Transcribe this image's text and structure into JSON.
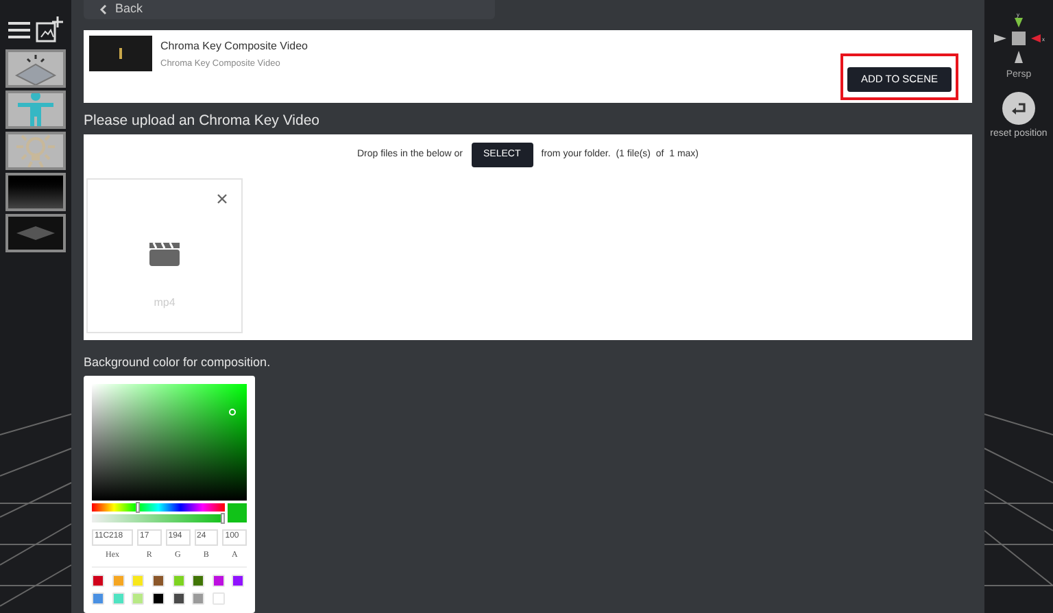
{
  "back_button": {
    "label": "Back"
  },
  "sidebar": {
    "items": [
      {
        "kind": "grid"
      },
      {
        "kind": "figure"
      },
      {
        "kind": "light"
      },
      {
        "kind": "gradient"
      },
      {
        "kind": "plane"
      }
    ]
  },
  "video_card": {
    "title": "Chroma Key Composite Video",
    "subtitle": "Chroma Key Composite Video",
    "add_button": {
      "label": "ADD TO SCENE",
      "highlighted": true
    }
  },
  "upload": {
    "heading": "Please upload an Chroma Key Video",
    "prompt_before": "Drop files in the below or",
    "select_button": "SELECT",
    "prompt_after": "from your folder.  (1 file(s)  of  1 max)",
    "files": [
      {
        "type": "mp4"
      }
    ]
  },
  "background": {
    "heading": "Background color for composition.",
    "picker": {
      "hex": "11C218",
      "r": "17",
      "g": "194",
      "b": "24",
      "a": "100",
      "labels": [
        "Hex",
        "R",
        "G",
        "B",
        "A"
      ],
      "hue": {
        "level": 0.34
      },
      "alpha": {
        "level": 1
      },
      "swatches": [
        {
          "color": "#d0021b"
        },
        {
          "color": "#f5a623"
        },
        {
          "color": "#f8e71c"
        },
        {
          "color": "#8b572a"
        },
        {
          "color": "#7ed321"
        },
        {
          "color": "#417505"
        },
        {
          "color": "#bd10e0"
        },
        {
          "color": "#9013fe"
        },
        {
          "color": "#4a90e2"
        },
        {
          "color": "#50e3c2"
        },
        {
          "color": "#b8e986"
        },
        {
          "color": "#000000"
        },
        {
          "color": "#4a4a4a"
        },
        {
          "color": "#9b9b9b"
        },
        {
          "color": "#ffffff"
        }
      ]
    }
  },
  "viewport": {
    "axis_labels": [
      "y",
      "x"
    ],
    "camera_label": "Persp",
    "reset_label": "reset position"
  }
}
